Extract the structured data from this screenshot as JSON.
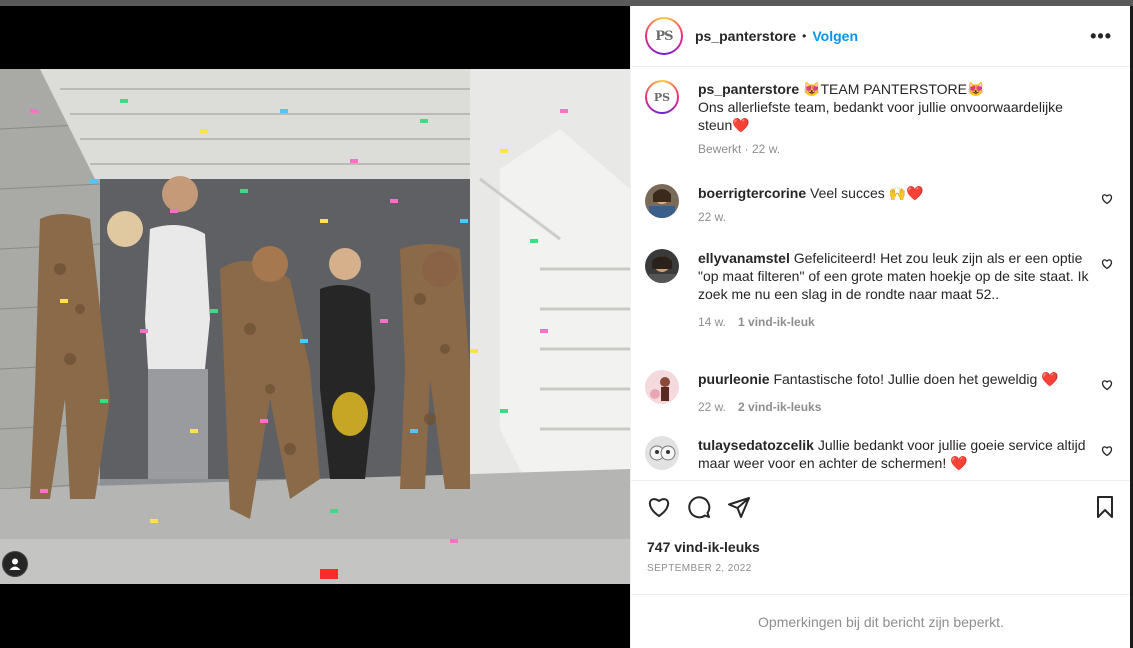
{
  "post": {
    "username": "ps_panterstore",
    "avatar_text": "PS",
    "follow_label": "Volgen",
    "dot": "•",
    "more": "•••"
  },
  "caption": {
    "username": "ps_panterstore",
    "line1": "😻TEAM PANTERSTORE😻",
    "line2": "Ons allerliefste team, bedankt voor jullie onvoorwaardelijke steun❤️",
    "meta": "Bewerkt · 22 w."
  },
  "comments": [
    {
      "username": "boerrigtercorine",
      "text": "Veel succes 🙌❤️",
      "time": "22 w.",
      "likes": ""
    },
    {
      "username": "ellyvanamstel",
      "text": "Gefeliciteerd! Het zou leuk zijn als er een optie \"op maat filteren\" of een grote maten hoekje op de site staat. Ik zoek me nu een slag in de rondte naar maat 52..",
      "time": "14 w.",
      "likes": "1 vind-ik-leuk"
    },
    {
      "username": "puurleonie",
      "text": "Fantastische foto! Jullie doen het geweldig ❤️",
      "time": "22 w.",
      "likes": "2 vind-ik-leuks"
    },
    {
      "username": "tulaysedatozcelik",
      "text": "Jullie bedankt voor jullie goeie service altijd maar weer voor en achter de schermen! ❤️",
      "time": "",
      "likes": ""
    }
  ],
  "actions": {
    "likes": "747 vind-ik-leuks",
    "date": "SEPTEMBER 2, 2022"
  },
  "footer": {
    "text": "Opmerkingen bij dit bericht zijn beperkt."
  },
  "colors": {
    "link": "#0095f6",
    "muted": "#8e8e8e",
    "text": "#262626"
  }
}
